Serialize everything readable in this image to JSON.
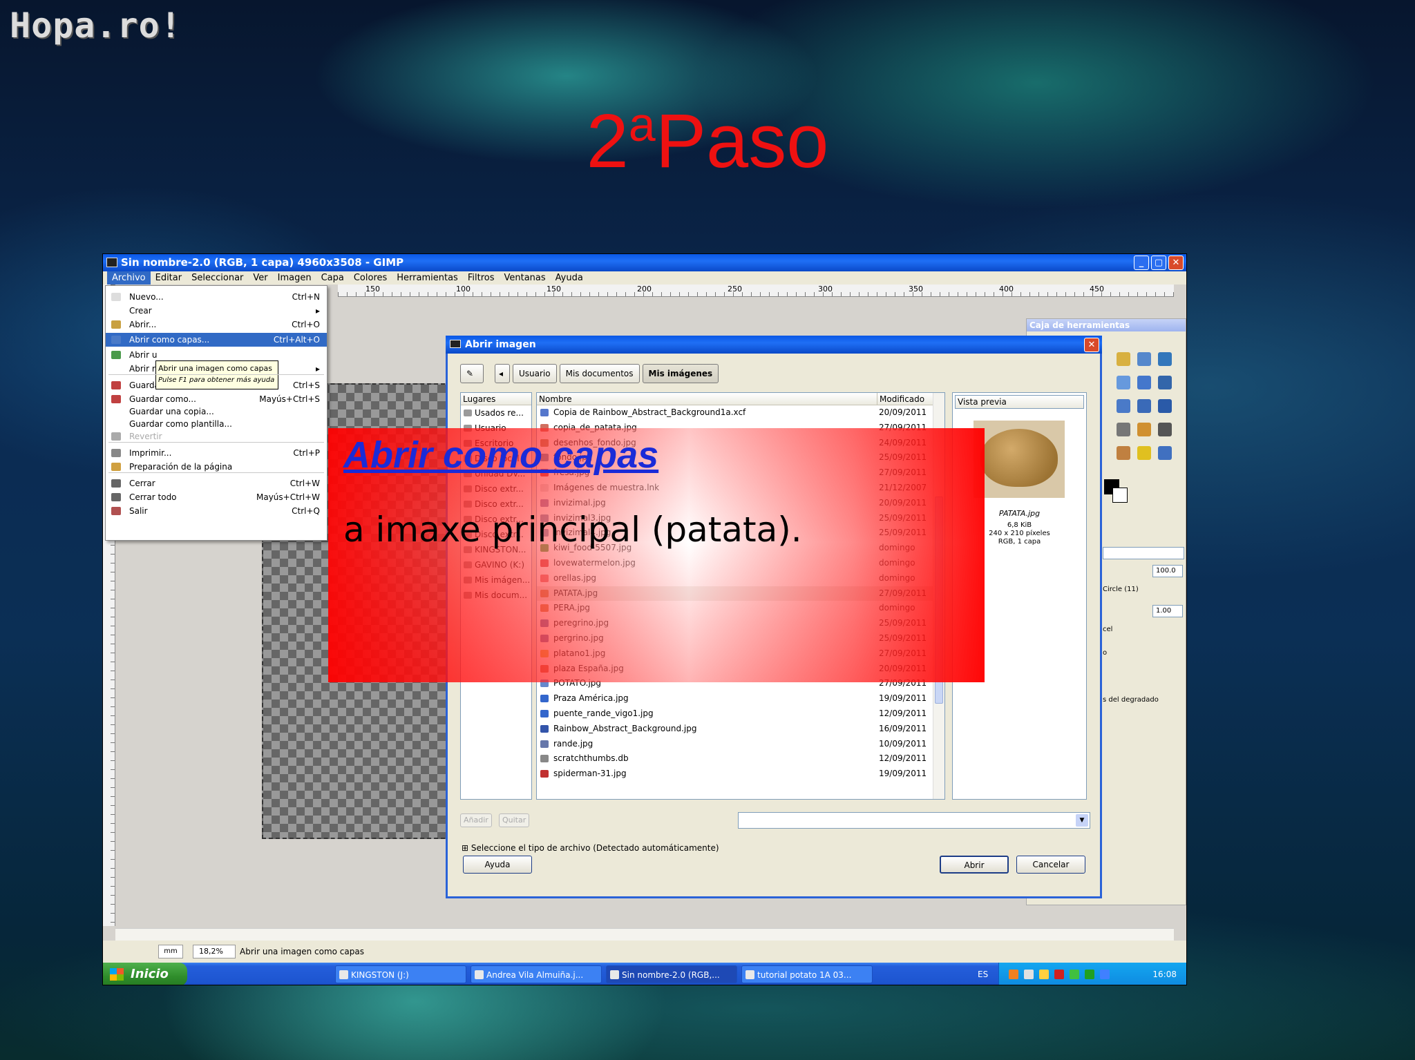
{
  "slide": {
    "logo": "Hopa.ro!",
    "title_main": "2",
    "title_sup": "a",
    "title_rest": "Paso"
  },
  "window": {
    "title": "Sin nombre-2.0 (RGB, 1 capa) 4960x3508 - GIMP",
    "min": "_",
    "max": "▢",
    "close": "✕"
  },
  "menubar": [
    "Archivo",
    "Editar",
    "Seleccionar",
    "Ver",
    "Imagen",
    "Capa",
    "Colores",
    "Herramientas",
    "Filtros",
    "Ventanas",
    "Ayuda"
  ],
  "ruler_labels": [
    "150",
    "100",
    "150",
    "200",
    "250",
    "300",
    "350",
    "400",
    "450"
  ],
  "file_menu": [
    {
      "label": "Nuevo...",
      "shortcut": "Ctrl+N"
    },
    {
      "label": "Crear",
      "shortcut": "▸"
    },
    {
      "label": "Abrir...",
      "shortcut": "Ctrl+O"
    },
    {
      "label": "Abrir como capas...",
      "shortcut": "Ctrl+Alt+O"
    },
    {
      "label": "Abrir u",
      "shortcut": ""
    },
    {
      "label": "Abrir r",
      "shortcut": "▸"
    },
    {
      "label": "Guardar",
      "shortcut": "Ctrl+S"
    },
    {
      "label": "Guardar como...",
      "shortcut": "Mayús+Ctrl+S"
    },
    {
      "label": "Guardar una copia...",
      "shortcut": ""
    },
    {
      "label": "Guardar como plantilla...",
      "shortcut": ""
    },
    {
      "label": "Revertir",
      "shortcut": ""
    },
    {
      "label": "Imprimir...",
      "shortcut": "Ctrl+P"
    },
    {
      "label": "Preparación de la página",
      "shortcut": ""
    },
    {
      "label": "Cerrar",
      "shortcut": "Ctrl+W"
    },
    {
      "label": "Cerrar todo",
      "shortcut": "Mayús+Ctrl+W"
    },
    {
      "label": "Salir",
      "shortcut": "Ctrl+Q"
    }
  ],
  "tooltip": {
    "line1": "Abrir una imagen como capas",
    "line2": "Pulse F1 para obtener más ayuda"
  },
  "toolbox": {
    "title": "Caja de herramientas",
    "value1": "100.0",
    "brush": "Circle (11)",
    "value2": "1.00",
    "lbl1": "cel",
    "lbl2": "o",
    "lbl3": "s del degradado"
  },
  "dialog": {
    "title": "Abrir imagen",
    "path": [
      "Usuario",
      "Mis documentos",
      "Mis imágenes"
    ],
    "places_header": "Lugares",
    "places": [
      "Usados re...",
      "Usuario",
      "Escritorio",
      "Disco local",
      "Unidad DV...",
      "Disco extr...",
      "Disco extr...",
      "Disco extr...",
      "Disco extr...",
      "KINGSTON...",
      "GAVINO (K:)",
      "Mis imágen...",
      "Mis docum..."
    ],
    "col_name": "Nombre",
    "col_modified": "Modificado",
    "files": [
      {
        "name": "Copia de Rainbow_Abstract_Background1a.xcf",
        "date": "20/09/2011"
      },
      {
        "name": "copia_de_patata.jpg",
        "date": "27/09/2011"
      },
      {
        "name": "desenhos_fondo.jpg",
        "date": "24/09/2011"
      },
      {
        "name": "fondo.jpg",
        "date": "25/09/2011"
      },
      {
        "name": "fresa.jpg",
        "date": "27/09/2011"
      },
      {
        "name": "Imágenes de muestra.lnk",
        "date": "21/12/2007"
      },
      {
        "name": "invizimal.jpg",
        "date": "20/09/2011"
      },
      {
        "name": "invizimal3.jpg",
        "date": "25/09/2011"
      },
      {
        "name": "invizimal4.jpg",
        "date": "25/09/2011"
      },
      {
        "name": "kiwi_food-5507.jpg",
        "date": "domingo"
      },
      {
        "name": "lovewatermelon.jpg",
        "date": "domingo"
      },
      {
        "name": "orellas.jpg",
        "date": "domingo"
      },
      {
        "name": "PATATA.jpg",
        "date": "27/09/2011"
      },
      {
        "name": "PERA.jpg",
        "date": "domingo"
      },
      {
        "name": "peregrino.jpg",
        "date": "25/09/2011"
      },
      {
        "name": "pergrino.jpg",
        "date": "25/09/2011"
      },
      {
        "name": "platano1.jpg",
        "date": "27/09/2011"
      },
      {
        "name": "plaza España.jpg",
        "date": "20/09/2011"
      },
      {
        "name": "POTATO.jpg",
        "date": "27/09/2011"
      },
      {
        "name": "Praza América.jpg",
        "date": "19/09/2011"
      },
      {
        "name": "puente_rande_vigo1.jpg",
        "date": "12/09/2011"
      },
      {
        "name": "Rainbow_Abstract_Background.jpg",
        "date": "16/09/2011"
      },
      {
        "name": "rande.jpg",
        "date": "10/09/2011"
      },
      {
        "name": "scratchthumbs.db",
        "date": "12/09/2011"
      },
      {
        "name": "spiderman-31.jpg",
        "date": "19/09/2011"
      }
    ],
    "preview_header": "Vista previa",
    "preview_name": "PATATA.jpg",
    "preview_size": "6,8 KiB",
    "preview_dims": "240 x 210 píxeles",
    "preview_mode": "RGB, 1 capa",
    "add": "Añadir",
    "remove": "Quitar",
    "filetype": "Seleccione el tipo de archivo (Detectado automáticamente)",
    "help": "Ayuda",
    "open": "Abrir",
    "cancel": "Cancelar"
  },
  "status": {
    "unit": "mm",
    "zoom": "18,2%",
    "message": "Abrir una imagen como capas"
  },
  "taskbar": {
    "start": "Inicio",
    "tasks": [
      "KINGSTON (J:)",
      "Andrea Vila Almuiña.j...",
      "Sin nombre-2.0 (RGB,...",
      "tutorial potato 1A 03..."
    ],
    "lang": "ES",
    "clock": "16:08"
  },
  "callout": {
    "heading": "Abrir como capas",
    "body": "a imaxe principal (patata)."
  },
  "colors": {
    "title_red": "#ee1111",
    "link_blue": "#1a2bd8",
    "xp_blue": "#245edb"
  }
}
